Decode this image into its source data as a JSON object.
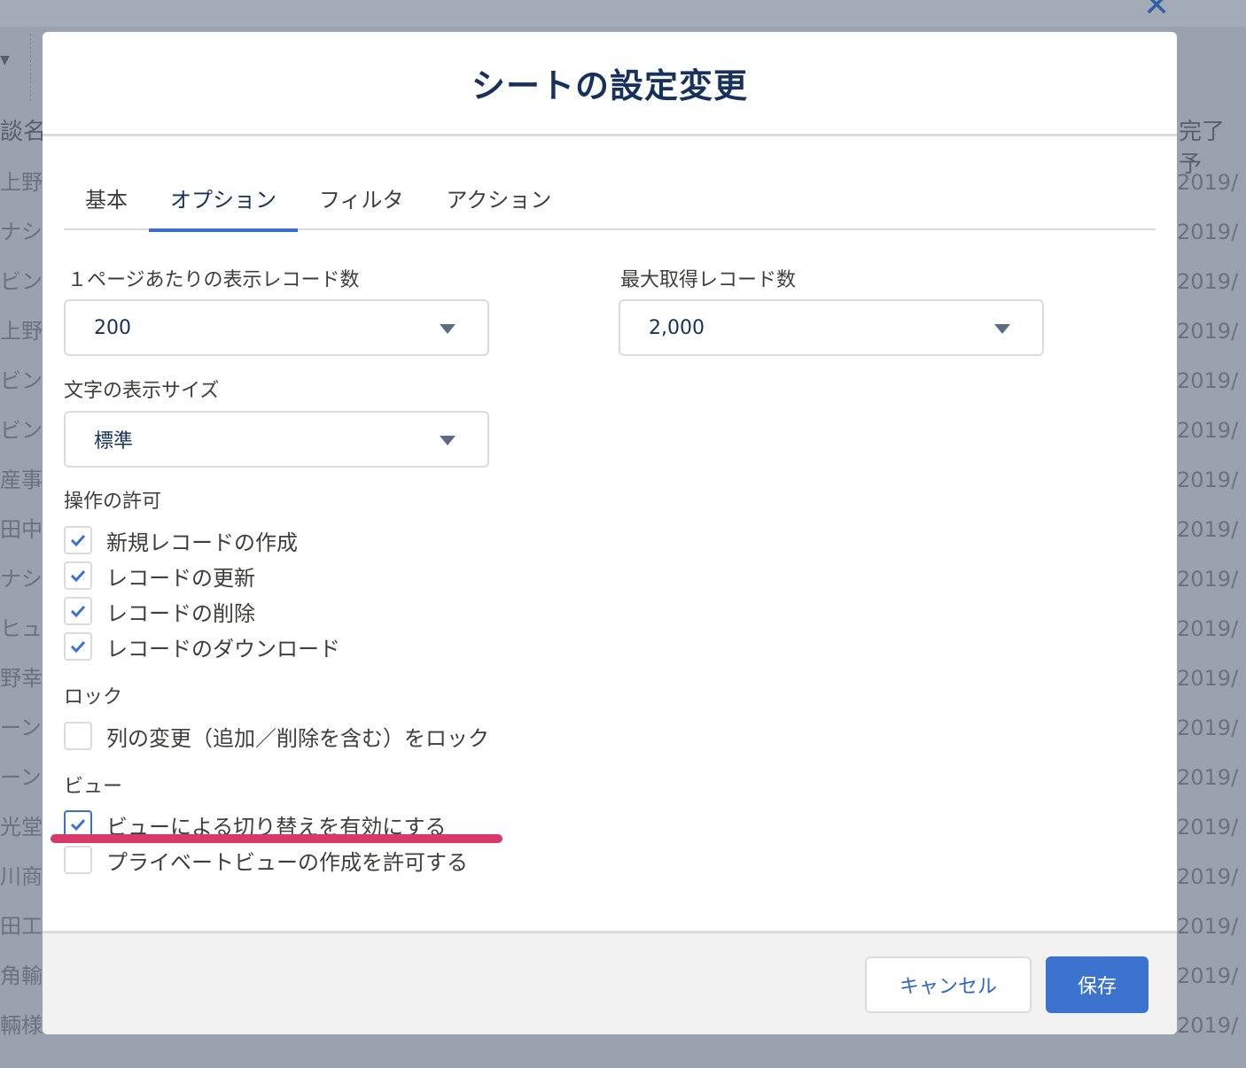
{
  "background": {
    "title_fragment": "·  ―  ·  ―  ――",
    "left_header": "談名",
    "right_header": "完了予",
    "left_cells": [
      "上野",
      "ナシ",
      "ビン",
      "上野",
      "ビン",
      "ビン",
      "産事",
      "田中",
      "ナシ",
      "ヒュ",
      "野幸",
      "ーン",
      "ーン",
      "光堂",
      "川商",
      "田工",
      "角輸",
      "輛様"
    ],
    "right_cells": [
      "2019/",
      "2019/",
      "2019/",
      "2019/",
      "2019/",
      "2019/",
      "2019/",
      "2019/",
      "2019/",
      "2019/",
      "2019/",
      "2019/",
      "2019/",
      "2019/",
      "2019/",
      "2019/",
      "2019/",
      "2019/"
    ]
  },
  "modal": {
    "title": "シートの設定変更",
    "tabs": [
      {
        "label": "基本"
      },
      {
        "label": "オプション",
        "active": true
      },
      {
        "label": "フィルタ"
      },
      {
        "label": "アクション"
      }
    ],
    "records_per_page": {
      "label": "１ページあたりの表示レコード数",
      "value": "200"
    },
    "max_records": {
      "label": "最大取得レコード数",
      "value": "2,000"
    },
    "font_size": {
      "label": "文字の表示サイズ",
      "value": "標準"
    },
    "permissions": {
      "label": "操作の許可",
      "items": [
        {
          "label": "新規レコードの作成",
          "checked": true
        },
        {
          "label": "レコードの更新",
          "checked": true
        },
        {
          "label": "レコードの削除",
          "checked": true
        },
        {
          "label": "レコードのダウンロード",
          "checked": true
        }
      ]
    },
    "lock": {
      "label": "ロック",
      "items": [
        {
          "label": "列の変更（追加／削除を含む）をロック",
          "checked": false
        }
      ]
    },
    "view": {
      "label": "ビュー",
      "items": [
        {
          "label": "ビューによる切り替えを有効にする",
          "checked": true
        },
        {
          "label": "プライベートビューの作成を許可する",
          "checked": false
        }
      ]
    },
    "buttons": {
      "cancel": "キャンセル",
      "save": "保存"
    }
  },
  "colors": {
    "accent": "#3b73cf",
    "annotation": "#d8396b",
    "title": "#16325c"
  }
}
